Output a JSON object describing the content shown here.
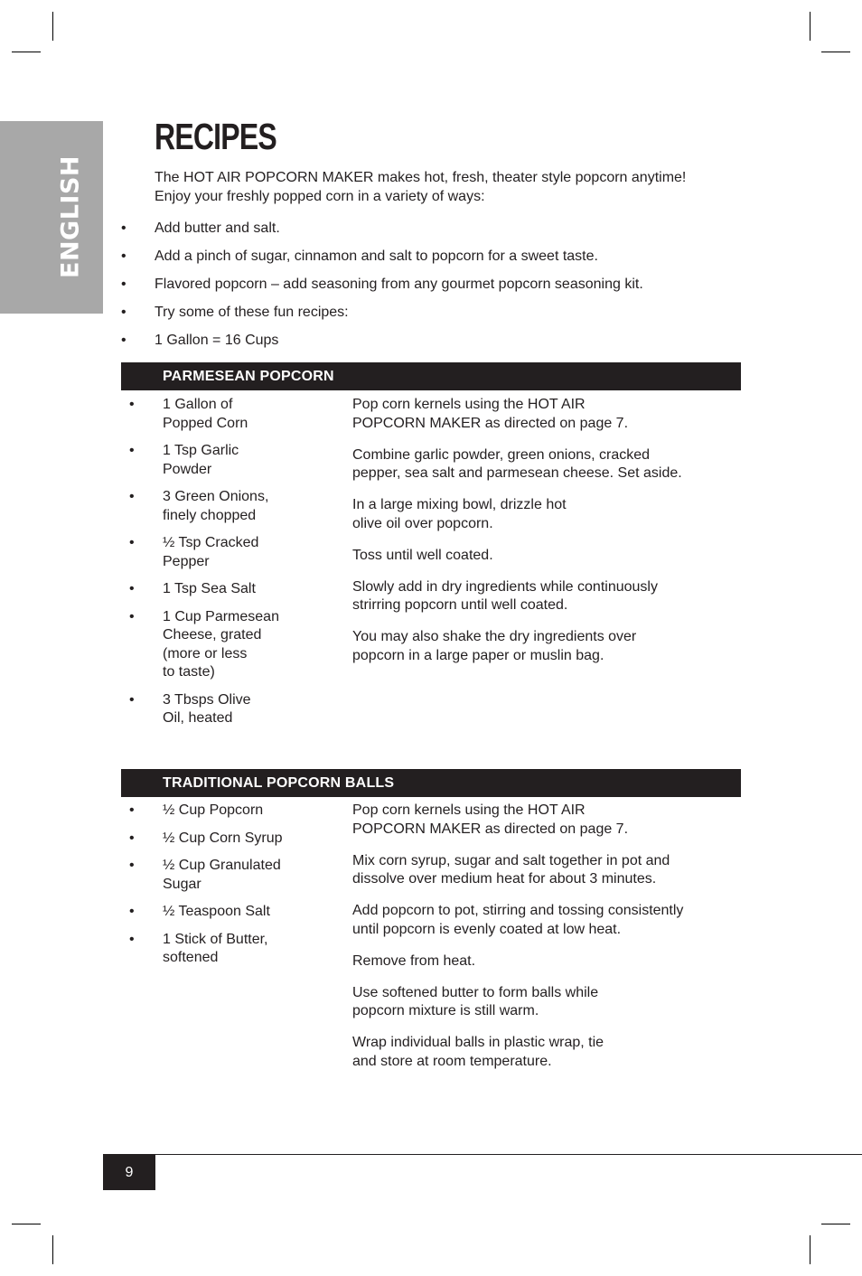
{
  "side_tab": {
    "label": "ENGLISH"
  },
  "page": {
    "title": "RECIPES",
    "intro": "The HOT AIR POPCORN MAKER makes hot, fresh, theater style popcorn anytime! Enjoy your freshly popped corn in a variety of ways:",
    "tips": [
      "Add butter and salt.",
      "Add a pinch of sugar, cinnamon and salt to popcorn for a sweet taste.",
      "Flavored popcorn – add seasoning from any gourmet popcorn seasoning kit.",
      "Try some of these fun recipes:",
      "1 Gallon = 16 Cups"
    ],
    "bullet": "•",
    "page_number": "9"
  },
  "recipes": [
    {
      "title": "PARMESEAN POPCORN",
      "ingredients": [
        "1 Gallon of\nPopped Corn",
        "1 Tsp Garlic\nPowder",
        "3 Green Onions,\nfinely chopped",
        "½ Tsp Cracked\nPepper",
        "1 Tsp Sea Salt",
        "1 Cup Parmesean\nCheese, grated\n(more or less\nto taste)",
        "3 Tbsps Olive\nOil, heated"
      ],
      "steps": [
        "Pop corn kernels using the HOT AIR\nPOPCORN MAKER as directed on page 7.",
        "Combine garlic powder, green onions, cracked\npepper, sea salt and parmesean cheese. Set aside.",
        "In a large mixing bowl, drizzle hot\nolive oil  over popcorn.",
        "Toss until well coated.",
        "Slowly add in dry ingredients while continuously\nstrirring popcorn until well coated.",
        "You may also shake the dry ingredients over\npopcorn in a large paper or muslin bag."
      ]
    },
    {
      "title": "TRADITIONAL POPCORN BALLS",
      "ingredients": [
        "½ Cup Popcorn",
        "½ Cup Corn Syrup",
        "½ Cup Granulated\nSugar",
        "½ Teaspoon Salt",
        "1 Stick of Butter,\nsoftened"
      ],
      "steps": [
        "Pop corn kernels using the HOT AIR\nPOPCORN MAKER as directed on page 7.",
        "Mix corn syrup, sugar and salt together in pot and\ndissolve over medium heat for about 3 minutes.",
        "Add popcorn to pot, stirring and tossing consistently\nuntil popcorn is evenly coated at low heat.",
        "Remove from heat.",
        "Use softened butter to form balls while\npopcorn mixture is still warm.",
        "Wrap individual balls in plastic wrap, tie\nand store at room temperature."
      ]
    }
  ]
}
